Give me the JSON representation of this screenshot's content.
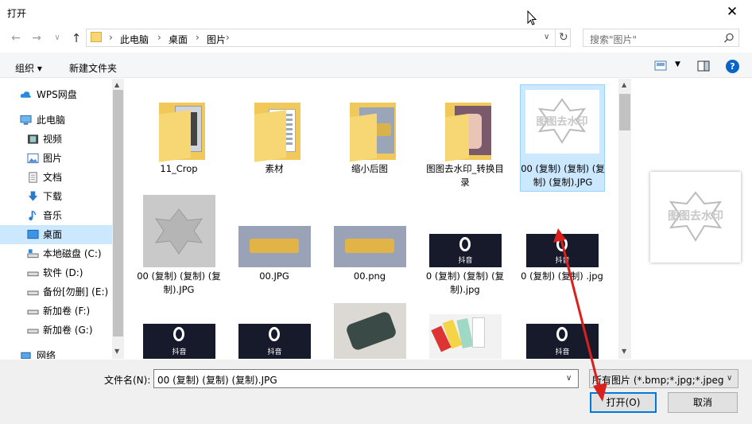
{
  "window": {
    "title": "打开",
    "close_glyph": "✕"
  },
  "nav": {
    "back": "←",
    "forward": "→",
    "dropdown": "∨",
    "up": "↑",
    "refresh": "↻"
  },
  "address": {
    "segments": [
      "此电脑",
      "桌面",
      "图片"
    ],
    "separator": "›",
    "dropdown": "∨"
  },
  "search": {
    "placeholder": "搜索\"图片\""
  },
  "toolbar": {
    "organize": "组织 ▾",
    "new_folder": "新建文件夹",
    "help": "?"
  },
  "sidebar": {
    "items": [
      {
        "label": "WPS网盘",
        "icon": "cloud-icon"
      },
      {
        "label": "此电脑",
        "icon": "computer-icon"
      },
      {
        "label": "视频",
        "icon": "video-icon"
      },
      {
        "label": "图片",
        "icon": "pictures-icon"
      },
      {
        "label": "文档",
        "icon": "document-icon"
      },
      {
        "label": "下载",
        "icon": "download-icon"
      },
      {
        "label": "音乐",
        "icon": "music-icon"
      },
      {
        "label": "桌面",
        "icon": "desktop-icon",
        "selected": true
      },
      {
        "label": "本地磁盘 (C:)",
        "icon": "drive-icon"
      },
      {
        "label": "软件 (D:)",
        "icon": "drive-icon"
      },
      {
        "label": "备份[勿删] (E:)",
        "icon": "drive-icon"
      },
      {
        "label": "新加卷 (F:)",
        "icon": "drive-icon"
      },
      {
        "label": "新加卷 (G:)",
        "icon": "drive-icon"
      },
      {
        "label": "网络",
        "icon": "network-icon"
      }
    ]
  },
  "files": [
    {
      "name": "11_Crop",
      "type": "folder"
    },
    {
      "name": "素材",
      "type": "folder"
    },
    {
      "name": "缩小后图",
      "type": "folder"
    },
    {
      "name": "图图去水印_转换目录",
      "type": "folder"
    },
    {
      "name": "00 (复制) (复制) (复制) (复制).JPG",
      "type": "image",
      "selected": true
    },
    {
      "name": "00 (复制) (复制) (复制).JPG",
      "type": "image"
    },
    {
      "name": "00.JPG",
      "type": "image"
    },
    {
      "name": "00.png",
      "type": "image"
    },
    {
      "name": "0 (复制) (复制) (复制).jpg",
      "type": "image"
    },
    {
      "name": "0 (复制) (复制) .jpg",
      "type": "image"
    },
    {
      "name": "",
      "type": "image"
    },
    {
      "name": "",
      "type": "image"
    },
    {
      "name": "",
      "type": "image"
    },
    {
      "name": "",
      "type": "image"
    },
    {
      "name": "",
      "type": "image"
    }
  ],
  "thumb_text": {
    "tiktok_label": "抖音",
    "logo_text": "图图去水印"
  },
  "bottom": {
    "filename_label": "文件名(N):",
    "filename_value": "00 (复制) (复制) (复制).JPG",
    "filter_value": "所有图片 (*.bmp;*.jpg;*.jpeg;*",
    "open_label": "打开(O)",
    "cancel_label": "取消"
  },
  "colors": {
    "accent": "#0078d7",
    "selection": "#cce8ff",
    "folder": "#f7d674",
    "arrow": "#d9201c"
  }
}
